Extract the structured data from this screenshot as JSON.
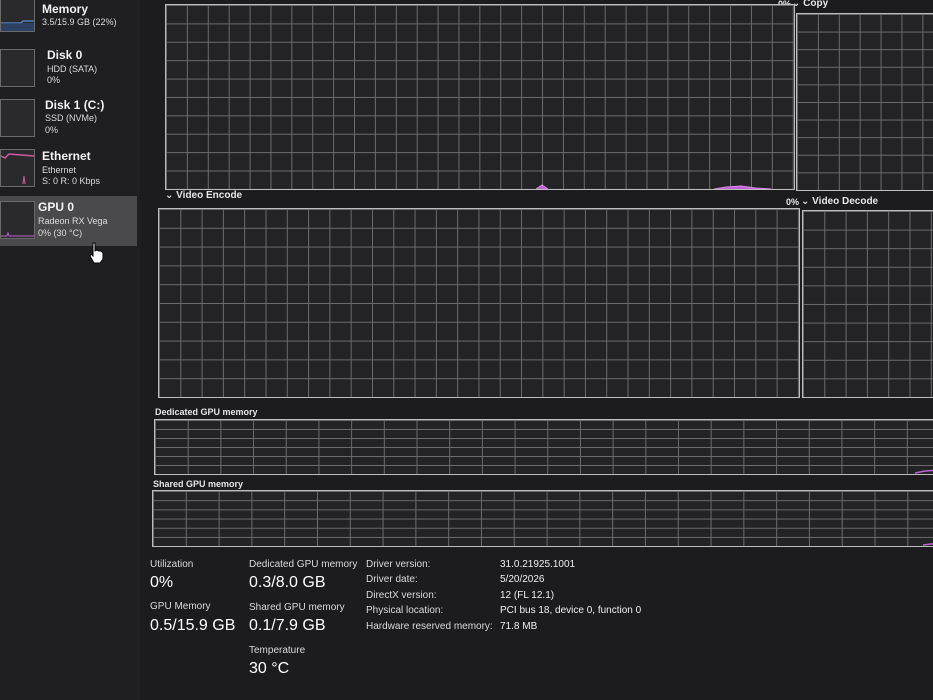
{
  "sidebar": {
    "items": [
      {
        "title": "Memory",
        "sub1": "3.5/15.9 GB (22%)",
        "sub2": ""
      },
      {
        "title": "Disk 0",
        "sub1": "HDD (SATA)",
        "sub2": "0%"
      },
      {
        "title": "Disk 1 (C:)",
        "sub1": "SSD (NVMe)",
        "sub2": "0%"
      },
      {
        "title": "Ethernet",
        "sub1": "Ethernet",
        "sub2": "S: 0 R: 0 Kbps"
      },
      {
        "title": "GPU 0",
        "sub1": "Radeon RX Vega",
        "sub2": "0% (30 °C)"
      }
    ]
  },
  "graphs": {
    "copy_pct": "0%",
    "copy_label": "Copy",
    "video_encode_label": "Video Encode",
    "video_decode_pct": "0%",
    "video_decode_label": "Video Decode",
    "dedicated_label": "Dedicated GPU memory",
    "shared_label": "Shared GPU memory"
  },
  "stats": {
    "utilization_label": "Utilization",
    "utilization_value": "0%",
    "gpu_memory_label": "GPU Memory",
    "gpu_memory_value": "0.5/15.9 GB",
    "dedicated_label": "Dedicated GPU memory",
    "dedicated_value": "0.3/8.0 GB",
    "shared_label": "Shared GPU memory",
    "shared_value": "0.1/7.9 GB",
    "temperature_label": "Temperature",
    "temperature_value": "30 °C"
  },
  "info": [
    {
      "label": "Driver version:",
      "value": "31.0.21925.1001"
    },
    {
      "label": "Driver date:",
      "value": "5/20/2026"
    },
    {
      "label": "DirectX version:",
      "value": "12 (FL 12.1)"
    },
    {
      "label": "Physical location:",
      "value": "PCI bus 18, device 0, function 0"
    },
    {
      "label": "Hardware reserved memory:",
      "value": "71.8 MB"
    }
  ],
  "colors": {
    "background": "#1c1c1e",
    "grid": "#6b6b6b",
    "accent_memory": "#5b8fd6",
    "accent_ethernet": "#d05aa0",
    "accent_gpu": "#c062d8",
    "selected": "#4a4a4d"
  }
}
